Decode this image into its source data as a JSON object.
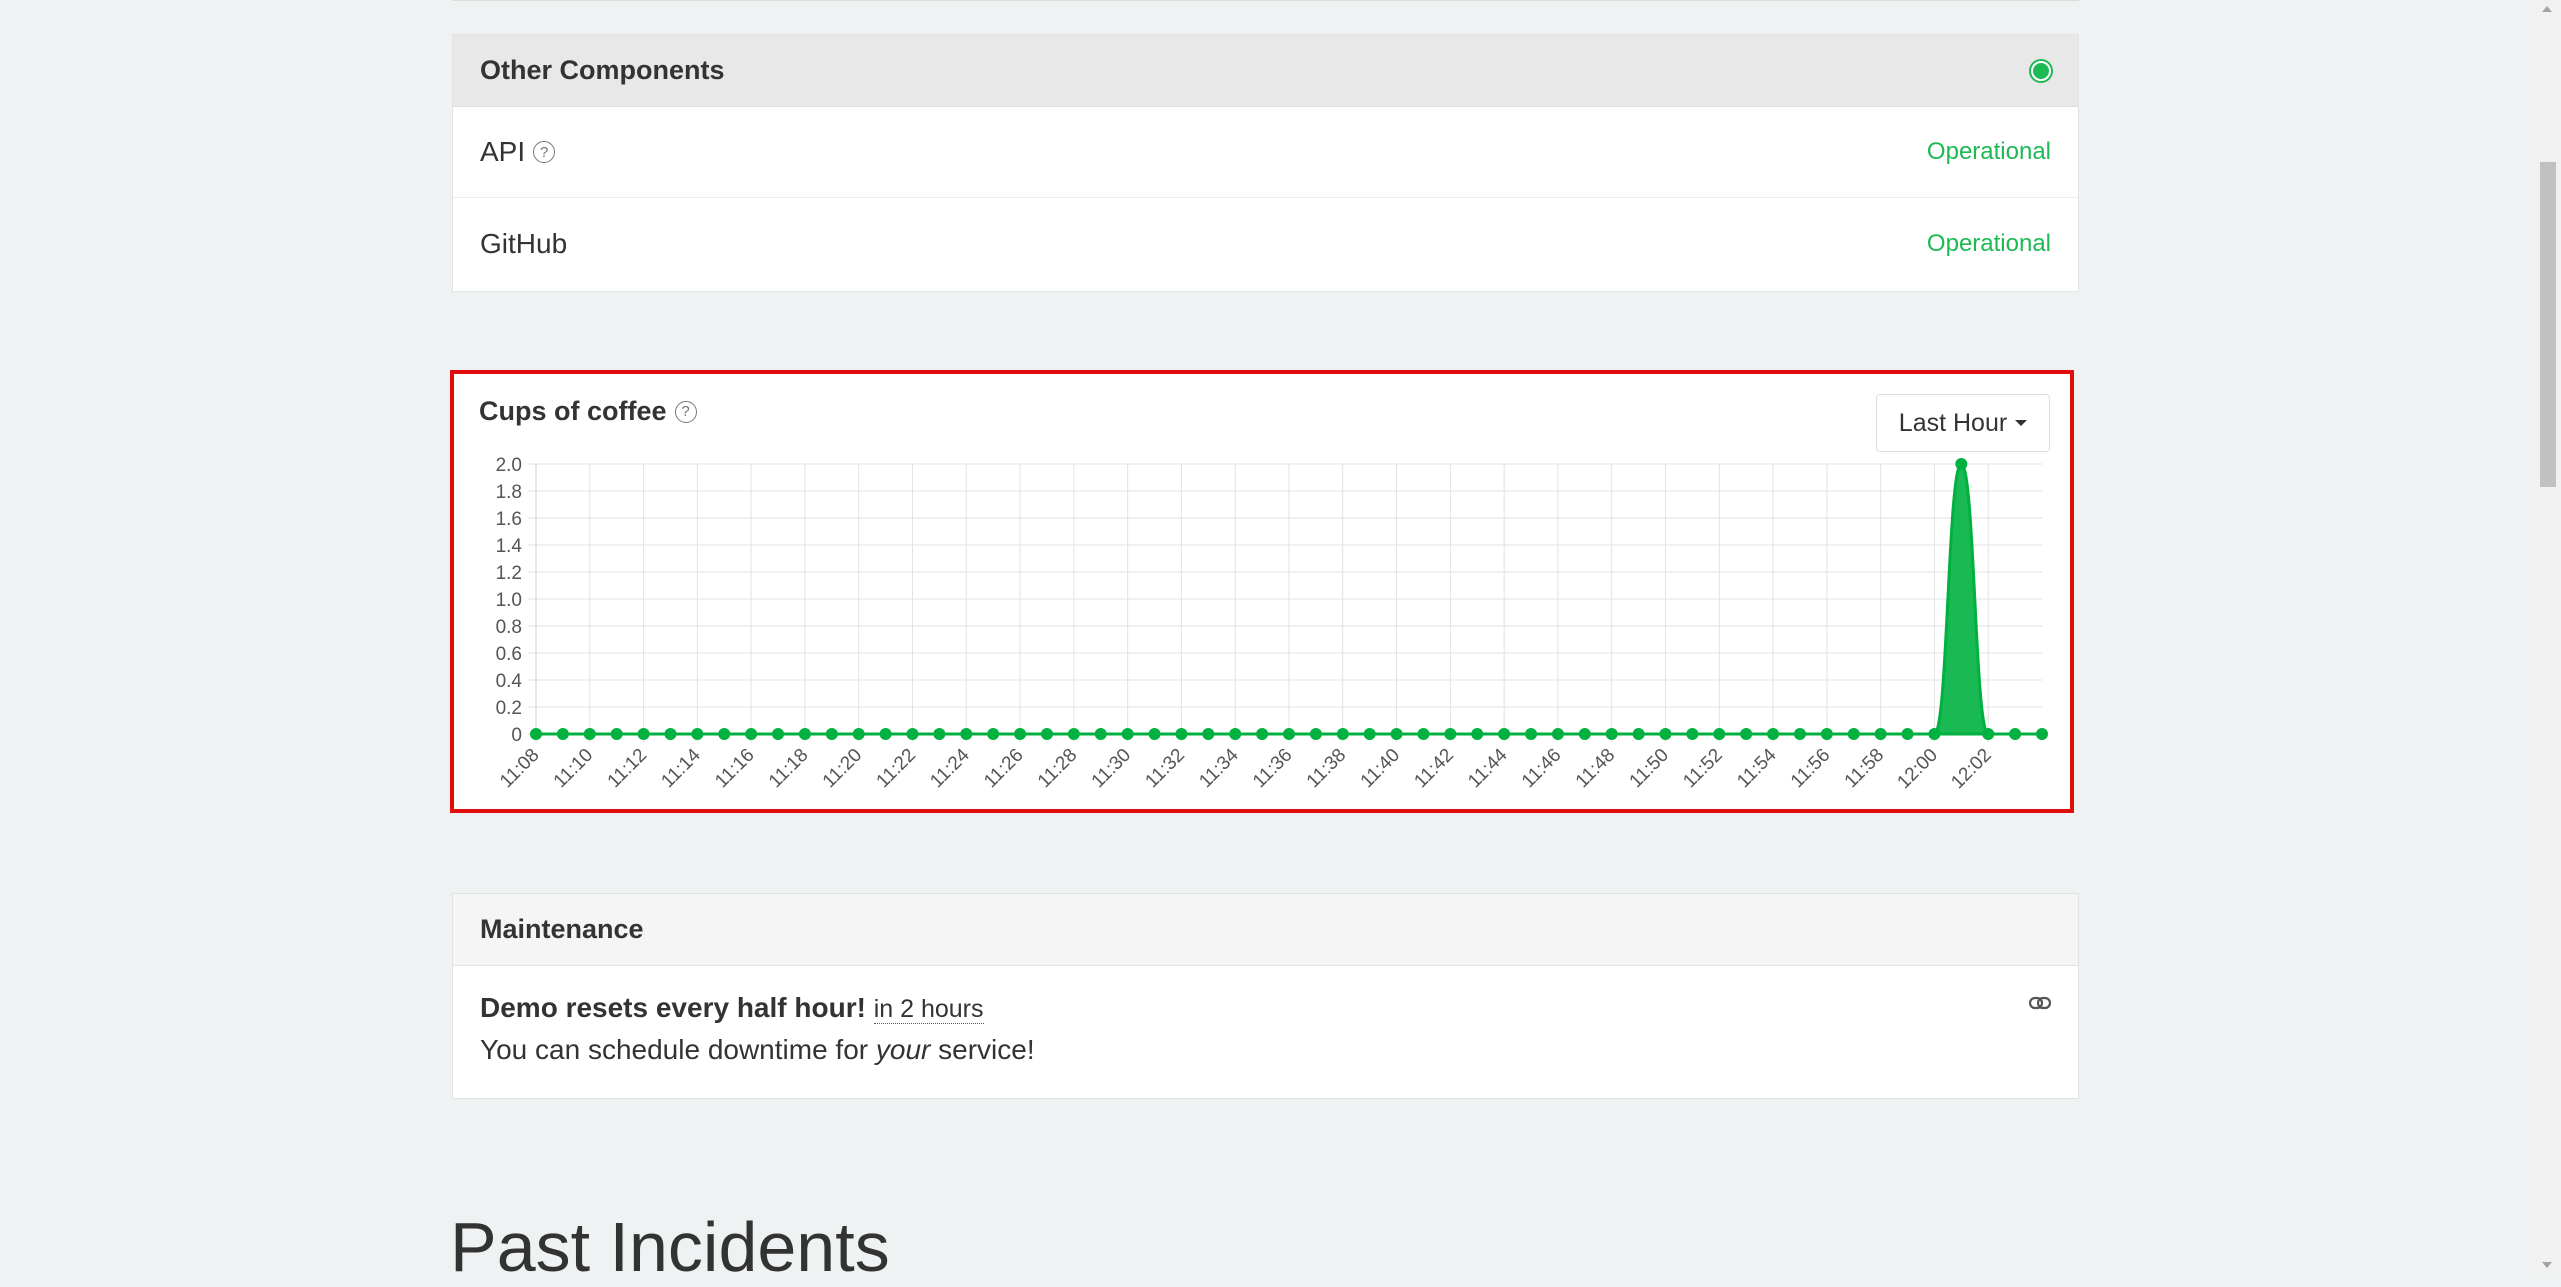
{
  "components_panel": {
    "title": "Other Components",
    "items": [
      {
        "name": "API",
        "status": "Operational",
        "has_help": true
      },
      {
        "name": "GitHub",
        "status": "Operational",
        "has_help": false
      }
    ]
  },
  "metric": {
    "title": "Cups of coffee",
    "range_label": "Last Hour"
  },
  "chart_data": {
    "type": "area",
    "title": "Cups of coffee",
    "xlabel": "",
    "ylabel": "",
    "ylim": [
      0,
      2.0
    ],
    "y_ticks": [
      "0",
      "0.2",
      "0.4",
      "0.6",
      "0.8",
      "1.0",
      "1.2",
      "1.4",
      "1.6",
      "1.8",
      "2.0"
    ],
    "x_tick_labels": [
      "11:08",
      "11:10",
      "11:12",
      "11:14",
      "11:16",
      "11:18",
      "11:20",
      "11:22",
      "11:24",
      "11:26",
      "11:28",
      "11:30",
      "11:32",
      "11:34",
      "11:36",
      "11:38",
      "11:40",
      "11:42",
      "11:44",
      "11:46",
      "11:48",
      "11:50",
      "11:52",
      "11:54",
      "11:56",
      "11:58",
      "12:00",
      "12:02"
    ],
    "grid": true,
    "color": "#00b140",
    "series": [
      {
        "x": [
          "11:08",
          "11:09",
          "11:10",
          "11:11",
          "11:12",
          "11:13",
          "11:14",
          "11:15",
          "11:16",
          "11:17",
          "11:18",
          "11:19",
          "11:20",
          "11:21",
          "11:22",
          "11:23",
          "11:24",
          "11:25",
          "11:26",
          "11:27",
          "11:28",
          "11:29",
          "11:30",
          "11:31",
          "11:32",
          "11:33",
          "11:34",
          "11:35",
          "11:36",
          "11:37",
          "11:38",
          "11:39",
          "11:40",
          "11:41",
          "11:42",
          "11:43",
          "11:44",
          "11:45",
          "11:46",
          "11:47",
          "11:48",
          "11:49",
          "11:50",
          "11:51",
          "11:52",
          "11:53",
          "11:54",
          "11:55",
          "11:56",
          "11:57",
          "11:58",
          "11:59",
          "12:00",
          "12:01",
          "12:02",
          "12:03",
          "12:04"
        ],
        "values": [
          0,
          0,
          0,
          0,
          0,
          0,
          0,
          0,
          0,
          0,
          0,
          0,
          0,
          0,
          0,
          0,
          0,
          0,
          0,
          0,
          0,
          0,
          0,
          0,
          0,
          0,
          0,
          0,
          0,
          0,
          0,
          0,
          0,
          0,
          0,
          0,
          0,
          0,
          0,
          0,
          0,
          0,
          0,
          0,
          0,
          0,
          0,
          0,
          0,
          0,
          0,
          0,
          0,
          2,
          0,
          0,
          0
        ]
      }
    ]
  },
  "maintenance": {
    "title": "Maintenance",
    "heading": "Demo resets every half hour!",
    "when": "in 2 hours",
    "desc_before": "You can schedule downtime for ",
    "desc_em": "your",
    "desc_after": " service!"
  },
  "past_incidents": {
    "title": "Past Incidents"
  }
}
